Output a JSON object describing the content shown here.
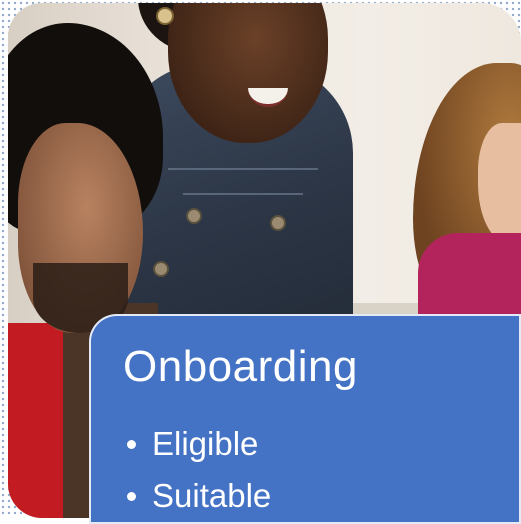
{
  "slide": {
    "title": "Onboarding",
    "bullets": [
      "Eligible",
      "Suitable"
    ],
    "colors": {
      "panel": "#4472c4",
      "text": "#ffffff",
      "dots": "#4a6fa8"
    }
  }
}
